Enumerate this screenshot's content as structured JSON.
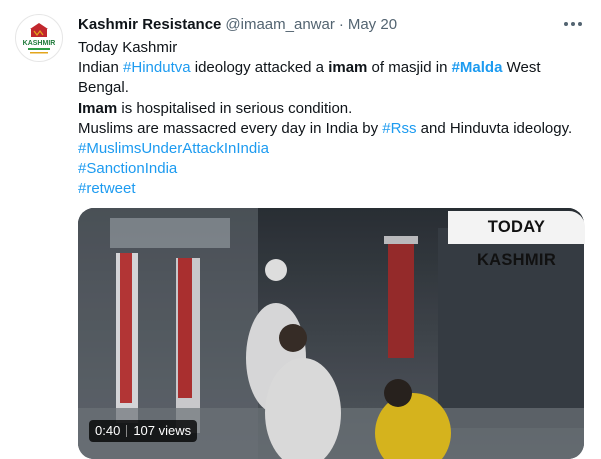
{
  "tweet": {
    "author_name": "Kashmir Resistance",
    "handle": "@imaam_anwar",
    "separator": "·",
    "date": "May 20",
    "more_icon": "ellipsis-icon",
    "avatar_text": "KASHMIR",
    "lines": {
      "l1": "Today Kashmir",
      "l2_a": "Indian ",
      "l2_tag1": "#Hindutva",
      "l2_b": " ideology attacked a ",
      "l2_bold": "imam",
      "l2_c": " of masjid in ",
      "l2_tag2": "#Malda",
      "l2_d": " West",
      "l3": "Bengal.",
      "l4_bold": "Imam",
      "l4_rest": " is hospitalised in serious condition.",
      "l5_a": "Muslims are massacred every day in India by ",
      "l5_tag": "#Rss",
      "l5_b": " and Hinduvta ideology.",
      "l6": "#MuslimsUnderAttackInIndia",
      "l7": "#SanctionIndia",
      "l8": "#retweet"
    },
    "video": {
      "overlay_text": "TODAY KASHMIR",
      "duration": "0:40",
      "views": "107 views"
    },
    "colors": {
      "link": "#1d9bf0",
      "text": "#0f1419",
      "muted": "#536471"
    }
  }
}
